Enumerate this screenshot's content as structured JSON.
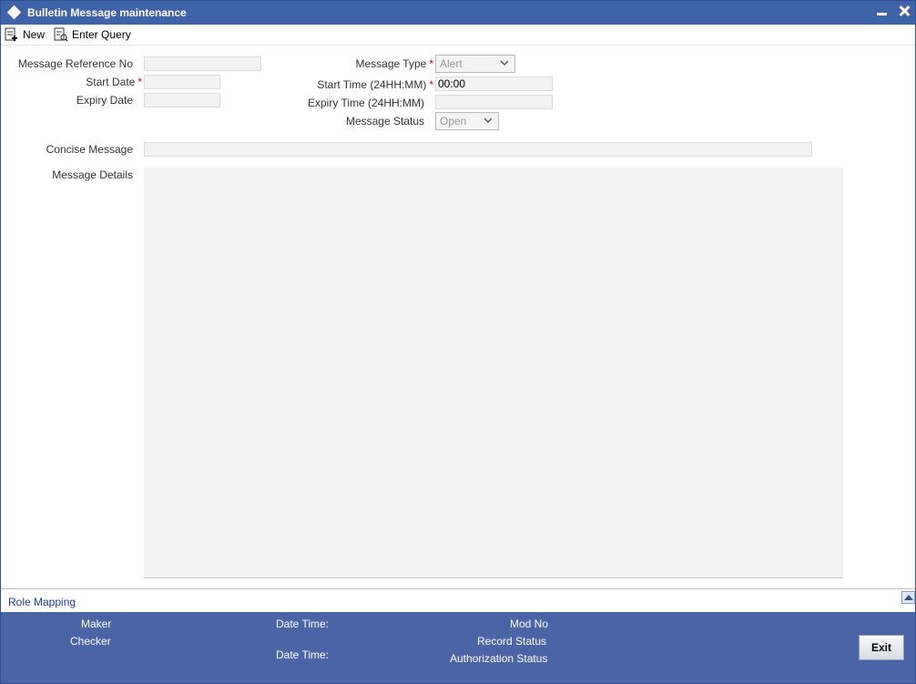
{
  "window": {
    "title": "Bulletin Message maintenance"
  },
  "toolbar": {
    "new_label": "New",
    "query_label": "Enter Query"
  },
  "form": {
    "message_reference_no": {
      "label": "Message Reference No",
      "value": ""
    },
    "start_date": {
      "label": "Start Date",
      "value": "",
      "required": "*"
    },
    "expiry_date": {
      "label": "Expiry Date",
      "value": ""
    },
    "message_type": {
      "label": "Message Type",
      "value": "Alert",
      "required": "*"
    },
    "start_time": {
      "label": "Start Time (24HH:MM)",
      "value": "00:00",
      "required": "*"
    },
    "expiry_time": {
      "label": "Expiry Time (24HH:MM)",
      "value": ""
    },
    "message_status": {
      "label": "Message Status",
      "value": "Open"
    },
    "concise_message": {
      "label": "Concise Message",
      "value": ""
    },
    "message_details": {
      "label": "Message Details",
      "value": ""
    }
  },
  "role_mapping": {
    "label": "Role Mapping"
  },
  "footer": {
    "maker_label": "Maker",
    "checker_label": "Checker",
    "date_time_label_1": "Date Time:",
    "date_time_label_2": "Date Time:",
    "mod_no_label": "Mod No",
    "record_status_label": "Record Status",
    "authorization_status_label": "Authorization Status",
    "exit_label": "Exit"
  },
  "colors": {
    "title_bar": "#3f62a8",
    "footer": "#4965a6",
    "required": "#cc0000",
    "link": "#1f3fa0"
  }
}
